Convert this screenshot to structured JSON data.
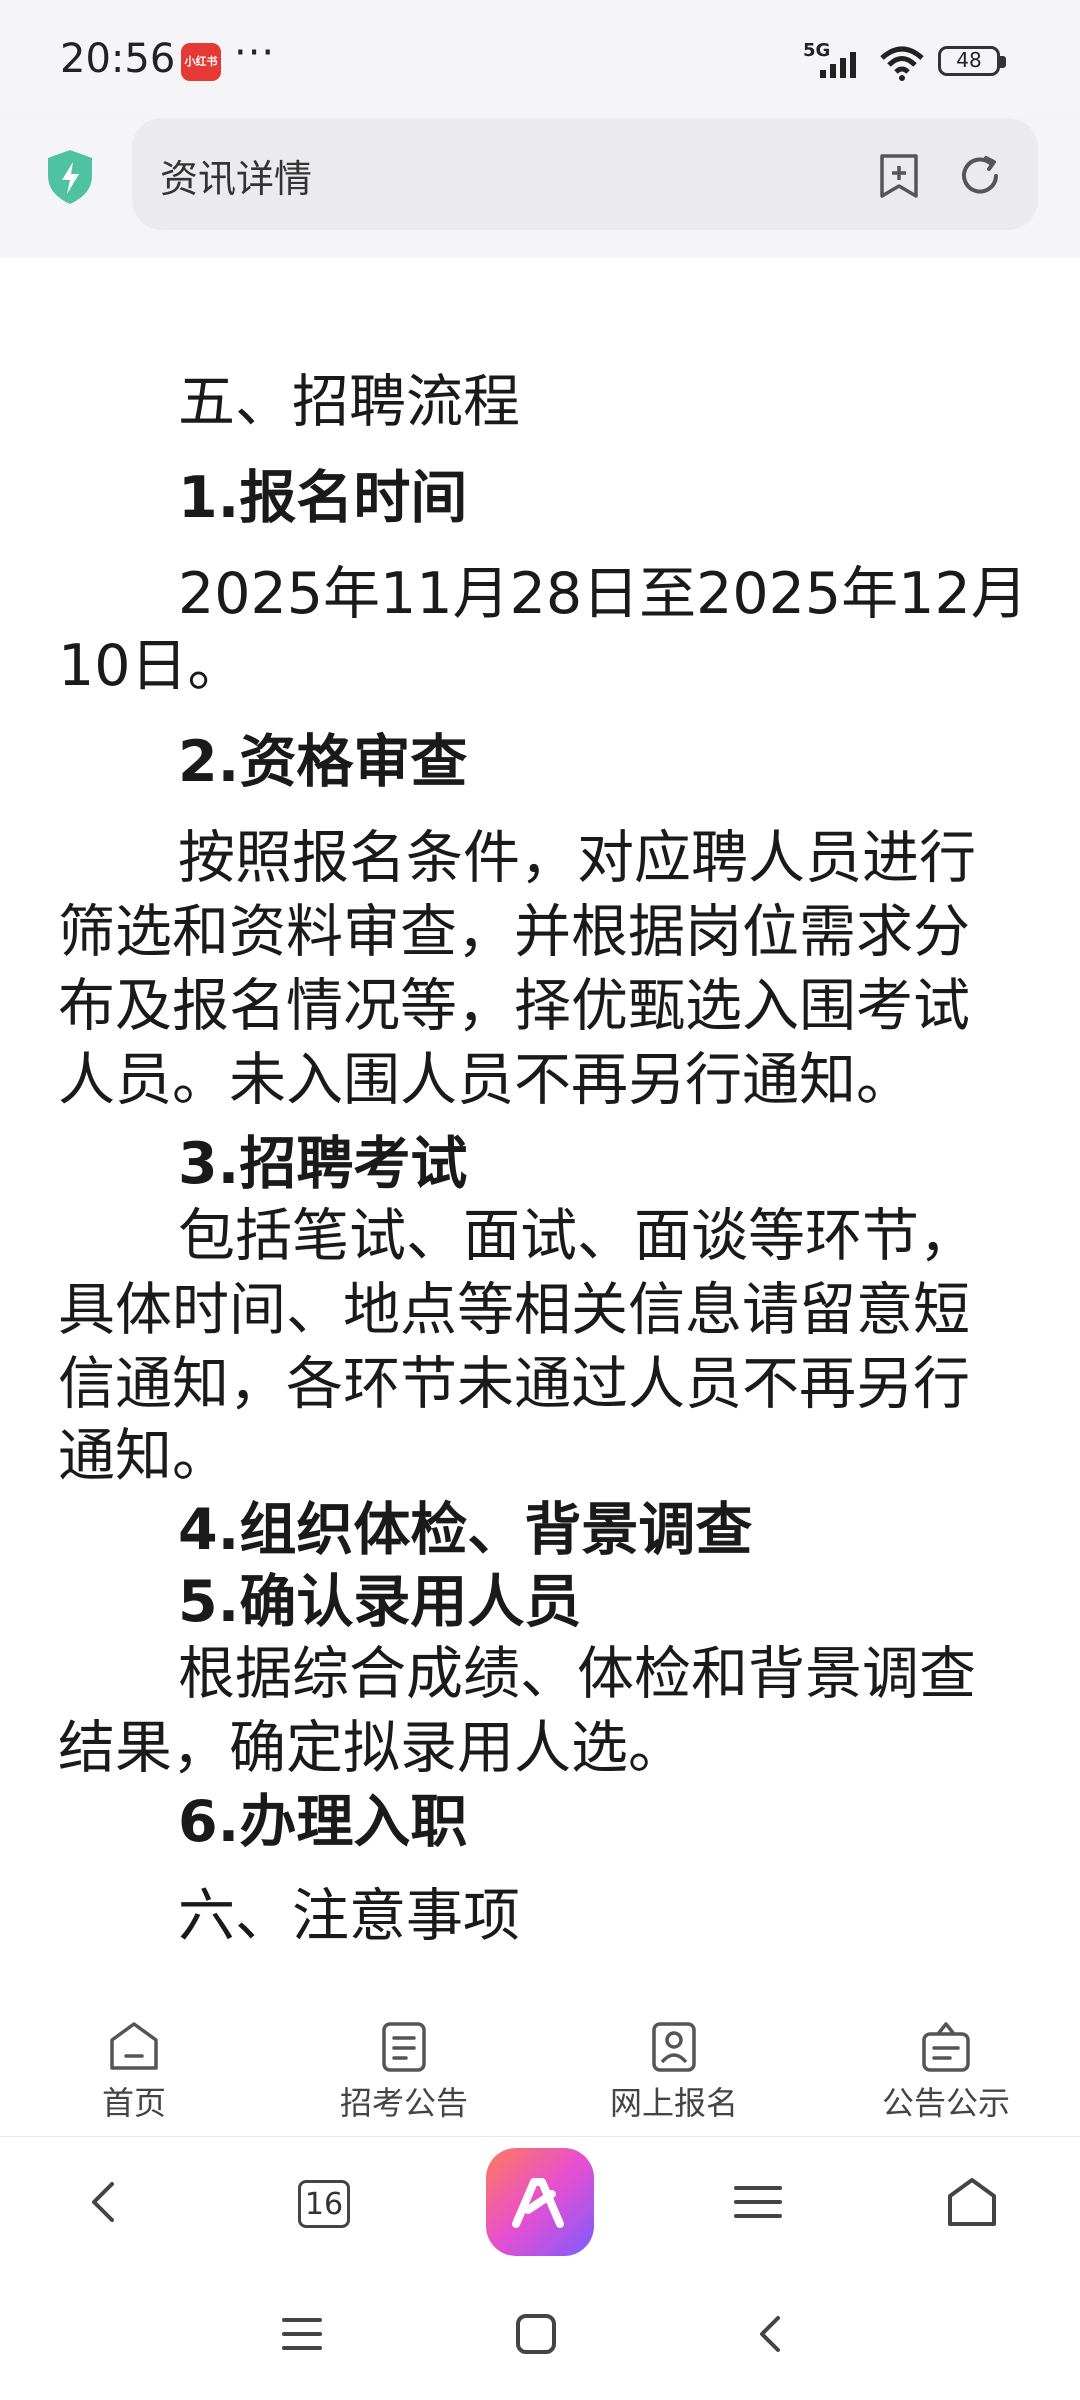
{
  "status_bar": {
    "time": "20:56",
    "app_badge": "小红书",
    "more": "···",
    "network": "5G",
    "battery": "48"
  },
  "browser": {
    "title": "资讯详情",
    "shield_color": "#4fc3a1",
    "tab_count": "16"
  },
  "article": {
    "lines": [
      {
        "text": "五、招聘流程",
        "style": "indent"
      },
      {
        "text": "1.报名时间",
        "style": "indent bold"
      },
      {
        "text": "2025年11月28日至2025年12月",
        "style": "indent"
      },
      {
        "text": "10日。",
        "style": ""
      },
      {
        "text": "2.资格审查",
        "style": "indent bold"
      },
      {
        "text": "按照报名条件，对应聘人员进行",
        "style": "indent"
      },
      {
        "text": "筛选和资料审查，并根据岗位需求分",
        "style": ""
      },
      {
        "text": "布及报名情况等，择优甄选入围考试",
        "style": ""
      },
      {
        "text": "人员。未入围人员不再另行通知。",
        "style": ""
      },
      {
        "text": "3.招聘考试",
        "style": "indent bold"
      },
      {
        "text": "包括笔试、面试、面谈等环节，",
        "style": "indent"
      },
      {
        "text": "具体时间、地点等相关信息请留意短",
        "style": ""
      },
      {
        "text": "信通知，各环节未通过人员不再另行",
        "style": ""
      },
      {
        "text": "通知。",
        "style": ""
      },
      {
        "text": "4.组织体检、背景调查",
        "style": "indent bold"
      },
      {
        "text": "5.确认录用人员",
        "style": "indent bold"
      },
      {
        "text": "根据综合成绩、体检和背景调查",
        "style": "indent"
      },
      {
        "text": "结果，确定拟录用人选。",
        "style": ""
      },
      {
        "text": "6.办理入职",
        "style": "indent bold"
      },
      {
        "text": "六、注意事项",
        "style": "indent"
      }
    ]
  },
  "site_nav": {
    "items": [
      {
        "label": "首页",
        "icon": "home-icon"
      },
      {
        "label": "招考公告",
        "icon": "notice-icon"
      },
      {
        "label": "网上报名",
        "icon": "register-icon"
      },
      {
        "label": "公告公示",
        "icon": "announcement-icon"
      }
    ]
  },
  "toolbar": {
    "icons": [
      "back-icon",
      "tabs-icon",
      "ai-assistant-icon",
      "menu-icon",
      "home-icon"
    ]
  },
  "system_nav": {
    "icons": [
      "recents-icon",
      "home-icon",
      "back-icon"
    ]
  }
}
